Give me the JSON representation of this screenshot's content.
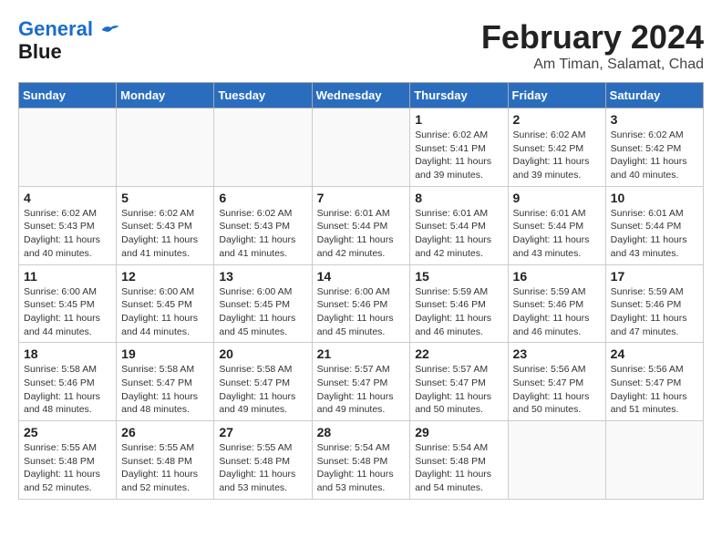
{
  "header": {
    "logo_line1": "General",
    "logo_line2": "Blue",
    "month_title": "February 2024",
    "location": "Am Timan, Salamat, Chad"
  },
  "days_of_week": [
    "Sunday",
    "Monday",
    "Tuesday",
    "Wednesday",
    "Thursday",
    "Friday",
    "Saturday"
  ],
  "weeks": [
    [
      {
        "day": "",
        "info": ""
      },
      {
        "day": "",
        "info": ""
      },
      {
        "day": "",
        "info": ""
      },
      {
        "day": "",
        "info": ""
      },
      {
        "day": "1",
        "info": "Sunrise: 6:02 AM\nSunset: 5:41 PM\nDaylight: 11 hours\nand 39 minutes."
      },
      {
        "day": "2",
        "info": "Sunrise: 6:02 AM\nSunset: 5:42 PM\nDaylight: 11 hours\nand 39 minutes."
      },
      {
        "day": "3",
        "info": "Sunrise: 6:02 AM\nSunset: 5:42 PM\nDaylight: 11 hours\nand 40 minutes."
      }
    ],
    [
      {
        "day": "4",
        "info": "Sunrise: 6:02 AM\nSunset: 5:43 PM\nDaylight: 11 hours\nand 40 minutes."
      },
      {
        "day": "5",
        "info": "Sunrise: 6:02 AM\nSunset: 5:43 PM\nDaylight: 11 hours\nand 41 minutes."
      },
      {
        "day": "6",
        "info": "Sunrise: 6:02 AM\nSunset: 5:43 PM\nDaylight: 11 hours\nand 41 minutes."
      },
      {
        "day": "7",
        "info": "Sunrise: 6:01 AM\nSunset: 5:44 PM\nDaylight: 11 hours\nand 42 minutes."
      },
      {
        "day": "8",
        "info": "Sunrise: 6:01 AM\nSunset: 5:44 PM\nDaylight: 11 hours\nand 42 minutes."
      },
      {
        "day": "9",
        "info": "Sunrise: 6:01 AM\nSunset: 5:44 PM\nDaylight: 11 hours\nand 43 minutes."
      },
      {
        "day": "10",
        "info": "Sunrise: 6:01 AM\nSunset: 5:44 PM\nDaylight: 11 hours\nand 43 minutes."
      }
    ],
    [
      {
        "day": "11",
        "info": "Sunrise: 6:00 AM\nSunset: 5:45 PM\nDaylight: 11 hours\nand 44 minutes."
      },
      {
        "day": "12",
        "info": "Sunrise: 6:00 AM\nSunset: 5:45 PM\nDaylight: 11 hours\nand 44 minutes."
      },
      {
        "day": "13",
        "info": "Sunrise: 6:00 AM\nSunset: 5:45 PM\nDaylight: 11 hours\nand 45 minutes."
      },
      {
        "day": "14",
        "info": "Sunrise: 6:00 AM\nSunset: 5:46 PM\nDaylight: 11 hours\nand 45 minutes."
      },
      {
        "day": "15",
        "info": "Sunrise: 5:59 AM\nSunset: 5:46 PM\nDaylight: 11 hours\nand 46 minutes."
      },
      {
        "day": "16",
        "info": "Sunrise: 5:59 AM\nSunset: 5:46 PM\nDaylight: 11 hours\nand 46 minutes."
      },
      {
        "day": "17",
        "info": "Sunrise: 5:59 AM\nSunset: 5:46 PM\nDaylight: 11 hours\nand 47 minutes."
      }
    ],
    [
      {
        "day": "18",
        "info": "Sunrise: 5:58 AM\nSunset: 5:46 PM\nDaylight: 11 hours\nand 48 minutes."
      },
      {
        "day": "19",
        "info": "Sunrise: 5:58 AM\nSunset: 5:47 PM\nDaylight: 11 hours\nand 48 minutes."
      },
      {
        "day": "20",
        "info": "Sunrise: 5:58 AM\nSunset: 5:47 PM\nDaylight: 11 hours\nand 49 minutes."
      },
      {
        "day": "21",
        "info": "Sunrise: 5:57 AM\nSunset: 5:47 PM\nDaylight: 11 hours\nand 49 minutes."
      },
      {
        "day": "22",
        "info": "Sunrise: 5:57 AM\nSunset: 5:47 PM\nDaylight: 11 hours\nand 50 minutes."
      },
      {
        "day": "23",
        "info": "Sunrise: 5:56 AM\nSunset: 5:47 PM\nDaylight: 11 hours\nand 50 minutes."
      },
      {
        "day": "24",
        "info": "Sunrise: 5:56 AM\nSunset: 5:47 PM\nDaylight: 11 hours\nand 51 minutes."
      }
    ],
    [
      {
        "day": "25",
        "info": "Sunrise: 5:55 AM\nSunset: 5:48 PM\nDaylight: 11 hours\nand 52 minutes."
      },
      {
        "day": "26",
        "info": "Sunrise: 5:55 AM\nSunset: 5:48 PM\nDaylight: 11 hours\nand 52 minutes."
      },
      {
        "day": "27",
        "info": "Sunrise: 5:55 AM\nSunset: 5:48 PM\nDaylight: 11 hours\nand 53 minutes."
      },
      {
        "day": "28",
        "info": "Sunrise: 5:54 AM\nSunset: 5:48 PM\nDaylight: 11 hours\nand 53 minutes."
      },
      {
        "day": "29",
        "info": "Sunrise: 5:54 AM\nSunset: 5:48 PM\nDaylight: 11 hours\nand 54 minutes."
      },
      {
        "day": "",
        "info": ""
      },
      {
        "day": "",
        "info": ""
      }
    ]
  ]
}
